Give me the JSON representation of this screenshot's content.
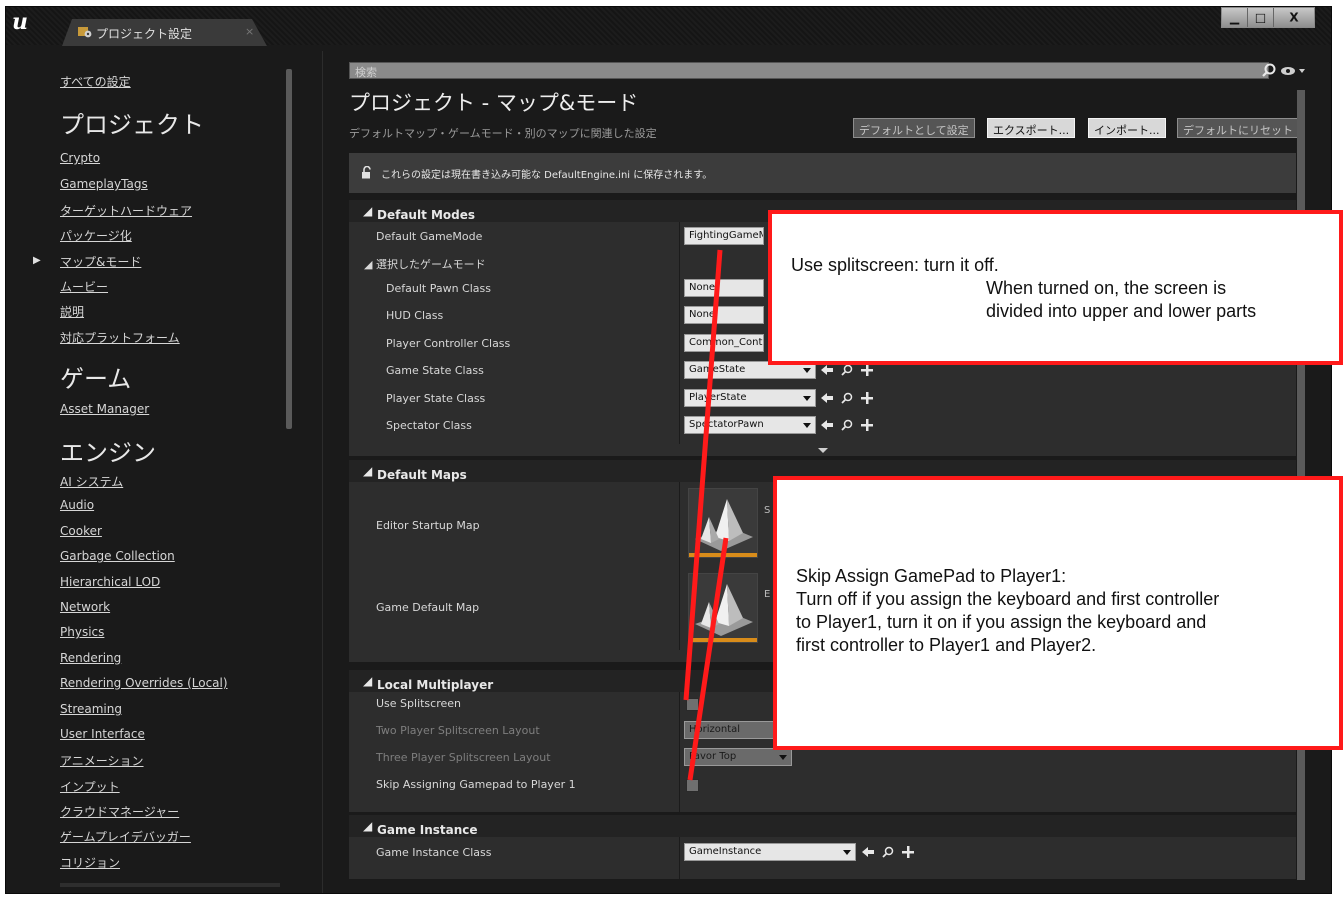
{
  "window": {
    "tab_label": "プロジェクト設定",
    "tab_close": "×",
    "buttons": {
      "minimize": "▁",
      "maximize": "□",
      "close": "X"
    }
  },
  "sidebar": {
    "all_settings": "すべての設定",
    "categories": [
      {
        "title": "プロジェクト",
        "items": [
          "Crypto",
          "GameplayTags",
          "ターゲットハードウェア",
          "パッケージ化",
          "マップ&モード",
          "ムービー",
          "説明",
          "対応プラットフォーム"
        ]
      },
      {
        "title": "ゲーム",
        "items": [
          "Asset Manager"
        ]
      },
      {
        "title": "エンジン",
        "items": [
          "AI システム",
          "Audio",
          "Cooker",
          "Garbage Collection",
          "Hierarchical LOD",
          "Network",
          "Physics",
          "Rendering",
          "Rendering Overrides (Local)",
          "Streaming",
          "User Interface",
          "アニメーション",
          "インプット",
          "クラウドマネージャー",
          "ゲームプレイデバッガー",
          "コリジョン"
        ]
      }
    ],
    "selected_item": "マップ&モード"
  },
  "main": {
    "search_placeholder": "検索",
    "title": "プロジェクト - マップ&モード",
    "subtitle": "デフォルトマップ・ゲームモード・別のマップに関連した設定",
    "buttons": {
      "set_default": "デフォルトとして設定",
      "export": "エクスポート...",
      "import": "インポート...",
      "reset": "デフォルトにリセット"
    },
    "notice": "これらの設定は現在書き込み可能な DefaultEngine.ini に保存されます。",
    "sections": {
      "default_modes": {
        "header": "Default Modes",
        "default_gamemode_label": "Default GameMode",
        "default_gamemode_value": "FightingGameM",
        "selected_mode_label": "選択したゲームモード",
        "rows": [
          {
            "label": "Default Pawn Class",
            "value": "None"
          },
          {
            "label": "HUD Class",
            "value": "None"
          },
          {
            "label": "Player Controller Class",
            "value": "Common_Contr"
          },
          {
            "label": "Game State Class",
            "value": "GameState"
          },
          {
            "label": "Player State Class",
            "value": "PlayerState"
          },
          {
            "label": "Spectator Class",
            "value": "SpectatorPawn"
          }
        ]
      },
      "default_maps": {
        "header": "Default Maps",
        "editor_startup_label": "Editor Startup Map",
        "editor_startup_value": "S",
        "game_default_label": "Game Default Map",
        "game_default_value": "E"
      },
      "local_multiplayer": {
        "header": "Local Multiplayer",
        "use_splitscreen_label": "Use Splitscreen",
        "two_player_label": "Two Player Splitscreen Layout",
        "two_player_value": "Horizontal",
        "three_player_label": "Three Player Splitscreen Layout",
        "three_player_value": "Favor Top",
        "skip_gamepad_label": "Skip Assigning Gamepad to Player 1"
      },
      "game_instance": {
        "header": "Game Instance",
        "class_label": "Game Instance Class",
        "class_value": "GameInstance"
      }
    }
  },
  "annotations": {
    "splitscreen": {
      "line1": "Use splitscreen:   turn it off.",
      "line2": "When turned on, the screen is",
      "line3": "divided into upper and lower parts"
    },
    "gamepad": {
      "line1": "Skip Assign GamePad to Player1:",
      "line2": "Turn off if you assign the keyboard and first controller",
      "line3": "to Player1, turn it on if you assign the keyboard and",
      "line4": "first controller to Player1 and Player2."
    },
    "color": "#ff1a1a"
  },
  "colors": {
    "background": "#1a1a1a",
    "panel": "#2d2d2d",
    "section_header": "#232323",
    "map_thumbnail_accent": "#d88c1a"
  }
}
